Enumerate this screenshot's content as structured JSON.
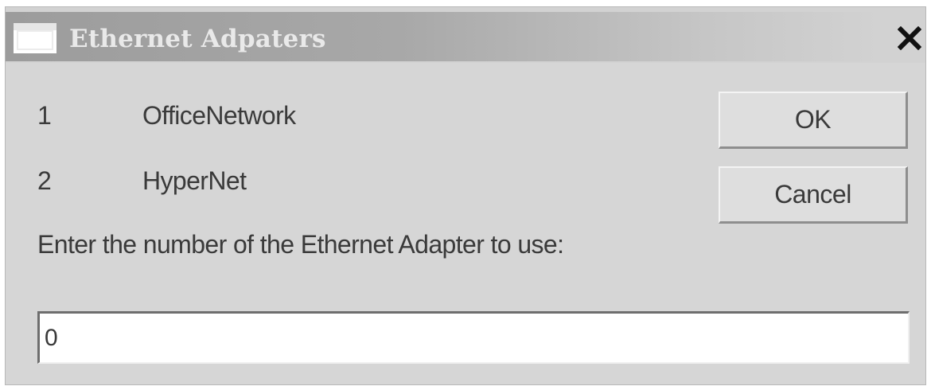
{
  "window": {
    "title": "Ethernet Adpaters",
    "close_glyph": "✕",
    "icon": "window-icon",
    "close_icon": "close-icon"
  },
  "adapters": [
    {
      "number": "1",
      "name": "OfficeNetwork"
    },
    {
      "number": "2",
      "name": "HyperNet"
    }
  ],
  "prompt": {
    "label": "Enter the number of the Ethernet Adapter to use:",
    "value": "0"
  },
  "buttons": {
    "ok_label": "OK",
    "cancel_label": "Cancel"
  },
  "colors": {
    "dialog_bg": "#d6d6d6",
    "title_text": "#e9e9e9",
    "text": "#3a3a3a"
  }
}
